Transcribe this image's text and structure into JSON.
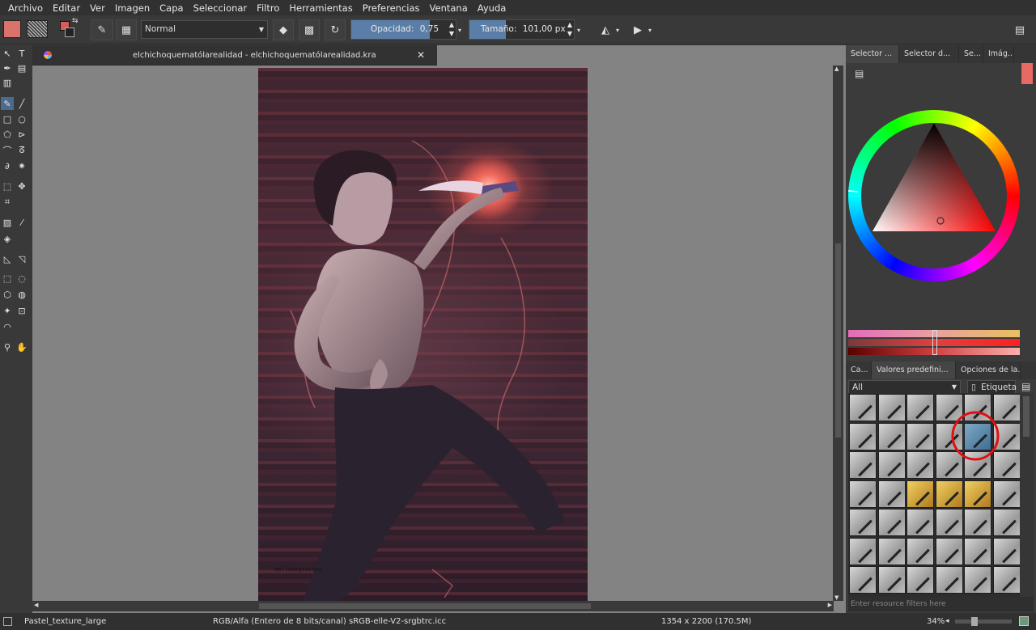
{
  "menu": [
    "Archivo",
    "Editar",
    "Ver",
    "Imagen",
    "Capa",
    "Seleccionar",
    "Filtro",
    "Herramientas",
    "Preferencias",
    "Ventana",
    "Ayuda"
  ],
  "toolbar": {
    "blend_mode": "Normal",
    "opacity_label": "Opacidad:",
    "opacity_value": "0,75",
    "opacity_fraction": 0.75,
    "size_label": "Tamaño:",
    "size_value": "101,00 px",
    "size_fraction": 0.35
  },
  "document": {
    "tab_title": "elchichoquematólarealidad - elchichoquematólarealidad.kra",
    "signature": "Hellobogtaiana"
  },
  "dock": {
    "top_tabs": [
      "Selector ...",
      "Selector d...",
      "Se...",
      "Imág..."
    ],
    "preset_tabs": [
      "Ca...",
      "Valores predefini...",
      "Opciones de la..."
    ],
    "filter_value": "All",
    "tag_label": "Etiqueta",
    "search_placeholder": "Enter resource filters here"
  },
  "status": {
    "preset_name": "Pastel_texture_large",
    "color_space": "RGB/Alfa (Entero de 8 bits/canal)  sRGB-elle-V2-srgbtrc.icc",
    "dimensions": "1354 x 2200 (170.5M)",
    "zoom": "34%"
  },
  "colors": {
    "foreground": "#d85c58",
    "accent": "#5a7ea8",
    "highlight_circle": "#e01010"
  }
}
